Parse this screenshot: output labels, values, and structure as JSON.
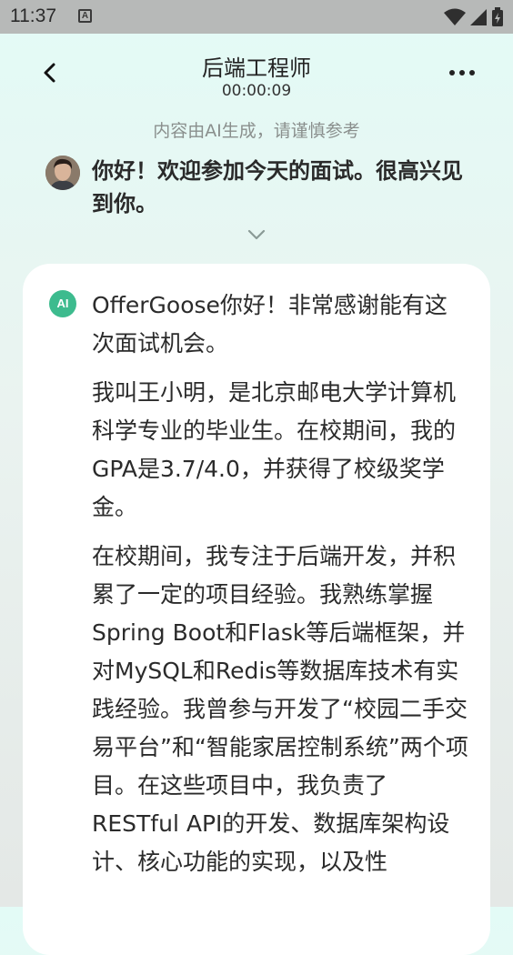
{
  "status_bar": {
    "time": "11:37",
    "app_icon": "A"
  },
  "header": {
    "title": "后端工程师",
    "timer": "00:00:09"
  },
  "disclaimer": "内容由AI生成，请谨慎参考",
  "interviewer": {
    "message": "你好！欢迎参加今天的面试。很高兴见到你。"
  },
  "answer": {
    "badge": "AI",
    "paragraphs": [
      "OfferGoose你好！非常感谢能有这次面试机会。",
      "我叫王小明，是北京邮电大学计算机科学专业的毕业生。在校期间，我的GPA是3.7/4.0，并获得了校级奖学金。",
      "在校期间，我专注于后端开发，并积累了一定的项目经验。我熟练掌握Spring Boot和Flask等后端框架，并对MySQL和Redis等数据库技术有实践经验。我曾参与开发了“校园二手交易平台”和“智能家居控制系统”两个项目。在这些项目中，我负责了RESTful API的开发、数据库架构设计、核心功能的实现，以及性"
    ]
  },
  "colors": {
    "accent": "#3dbb8e",
    "status_bar": "#b7b9b8",
    "disclaimer": "#8a8f8d"
  }
}
